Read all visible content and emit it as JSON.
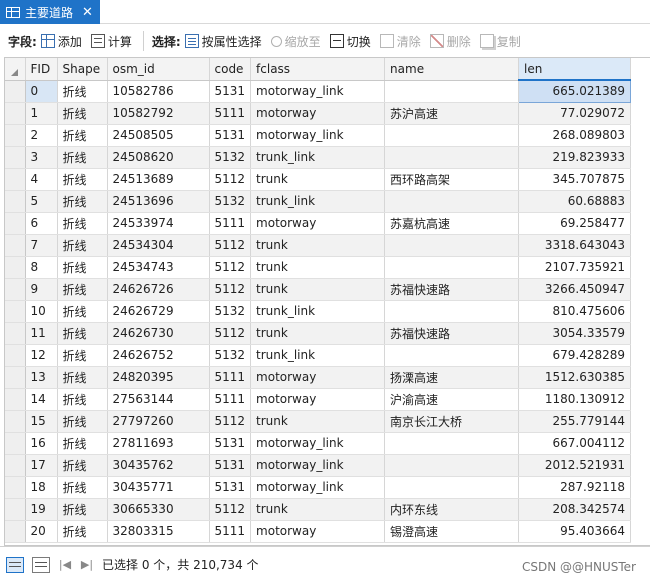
{
  "tab": {
    "title": "主要道路",
    "close": "✕"
  },
  "toolbar": {
    "fields_label": "字段:",
    "add_label": "添加",
    "calculate_label": "计算",
    "selection_label": "选择:",
    "select_by_attr_label": "按属性选择",
    "zoom_to_label": "缩放至",
    "switch_label": "切换",
    "clear_label": "清除",
    "delete_label": "删除",
    "copy_label": "复制"
  },
  "table": {
    "columns": [
      "FID",
      "Shape",
      "osm_id",
      "code",
      "fclass",
      "name",
      "len"
    ],
    "rows": [
      [
        "0",
        "折线",
        "10582786",
        "5131",
        "motorway_link",
        "",
        "665.021389"
      ],
      [
        "1",
        "折线",
        "10582792",
        "5111",
        "motorway",
        "苏沪高速",
        "77.029072"
      ],
      [
        "2",
        "折线",
        "24508505",
        "5131",
        "motorway_link",
        "",
        "268.089803"
      ],
      [
        "3",
        "折线",
        "24508620",
        "5132",
        "trunk_link",
        "",
        "219.823933"
      ],
      [
        "4",
        "折线",
        "24513689",
        "5112",
        "trunk",
        "西环路高架",
        "345.707875"
      ],
      [
        "5",
        "折线",
        "24513696",
        "5132",
        "trunk_link",
        "",
        "60.68883"
      ],
      [
        "6",
        "折线",
        "24533974",
        "5111",
        "motorway",
        "苏嘉杭高速",
        "69.258477"
      ],
      [
        "7",
        "折线",
        "24534304",
        "5112",
        "trunk",
        "",
        "3318.643043"
      ],
      [
        "8",
        "折线",
        "24534743",
        "5112",
        "trunk",
        "",
        "2107.735921"
      ],
      [
        "9",
        "折线",
        "24626726",
        "5112",
        "trunk",
        "苏福快速路",
        "3266.450947"
      ],
      [
        "10",
        "折线",
        "24626729",
        "5132",
        "trunk_link",
        "",
        "810.475606"
      ],
      [
        "11",
        "折线",
        "24626730",
        "5112",
        "trunk",
        "苏福快速路",
        "3054.33579"
      ],
      [
        "12",
        "折线",
        "24626752",
        "5132",
        "trunk_link",
        "",
        "679.428289"
      ],
      [
        "13",
        "折线",
        "24820395",
        "5111",
        "motorway",
        "扬溧高速",
        "1512.630385"
      ],
      [
        "14",
        "折线",
        "27563144",
        "5111",
        "motorway",
        "沪渝高速",
        "1180.130912"
      ],
      [
        "15",
        "折线",
        "27797260",
        "5112",
        "trunk",
        "南京长江大桥",
        "255.779144"
      ],
      [
        "16",
        "折线",
        "27811693",
        "5131",
        "motorway_link",
        "",
        "667.004112"
      ],
      [
        "17",
        "折线",
        "30435762",
        "5131",
        "motorway_link",
        "",
        "2012.521931"
      ],
      [
        "18",
        "折线",
        "30435771",
        "5131",
        "motorway_link",
        "",
        "287.92118"
      ],
      [
        "19",
        "折线",
        "30665330",
        "5112",
        "trunk",
        "内环东线",
        "208.342574"
      ],
      [
        "20",
        "折线",
        "32803315",
        "5111",
        "motorway",
        "锡澄高速",
        "95.403664"
      ]
    ]
  },
  "status": {
    "text": "已选择 0 个，共 210,734 个",
    "nav_first": "|◀",
    "nav_last": "▶|"
  },
  "watermark": "CSDN @@HNUSTer",
  "colors": {
    "tab_bg": "#1f73c8",
    "current_cell": "#cfe0f4",
    "sorted_header": "#dbe9f8"
  }
}
